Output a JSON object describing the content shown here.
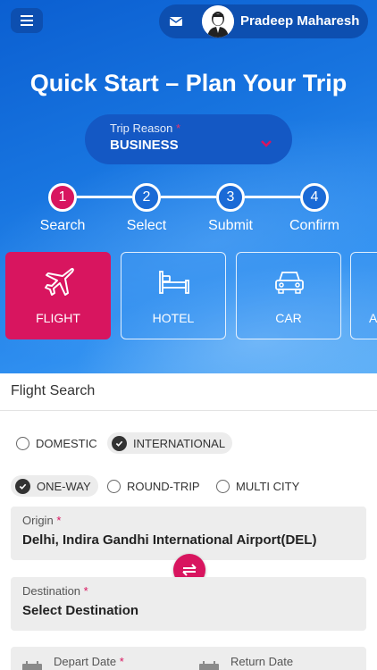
{
  "header": {
    "user_name": "Pradeep Maharesh"
  },
  "hero": {
    "title": "Quick Start – Plan Your Trip",
    "trip_reason": {
      "label": "Trip Reason",
      "required_mark": "*",
      "value": "BUSINESS"
    }
  },
  "steps": [
    {
      "number": "1",
      "label": "Search",
      "active": true
    },
    {
      "number": "2",
      "label": "Select",
      "active": false
    },
    {
      "number": "3",
      "label": "Submit",
      "active": false
    },
    {
      "number": "4",
      "label": "Confirm",
      "active": false
    }
  ],
  "categories": [
    {
      "label": "FLIGHT",
      "icon": "airplane-icon",
      "active": true
    },
    {
      "label": "HOTEL",
      "icon": "bed-icon",
      "active": false
    },
    {
      "label": "CAR",
      "icon": "car-icon",
      "active": false
    },
    {
      "label": "A",
      "icon": "unknown-icon",
      "active": false
    }
  ],
  "panel": {
    "title": "Flight Search",
    "scope_options": [
      {
        "label": "DOMESTIC",
        "selected": false
      },
      {
        "label": "INTERNATIONAL",
        "selected": true
      }
    ],
    "trip_type_options": [
      {
        "label": "ONE-WAY",
        "selected": true
      },
      {
        "label": "ROUND-TRIP",
        "selected": false
      },
      {
        "label": "MULTI CITY",
        "selected": false
      }
    ],
    "origin": {
      "label": "Origin",
      "required_mark": "*",
      "value": "Delhi,  Indira Gandhi International Airport(DEL)"
    },
    "destination": {
      "label": "Destination",
      "required_mark": "*",
      "value": "Select Destination"
    },
    "depart_date": {
      "label": "Depart Date",
      "required_mark": "*"
    },
    "return_date": {
      "label": "Return Date"
    }
  },
  "colors": {
    "primary_blue": "#1875e0",
    "accent_pink": "#d8155f",
    "field_bg": "#ededed"
  }
}
